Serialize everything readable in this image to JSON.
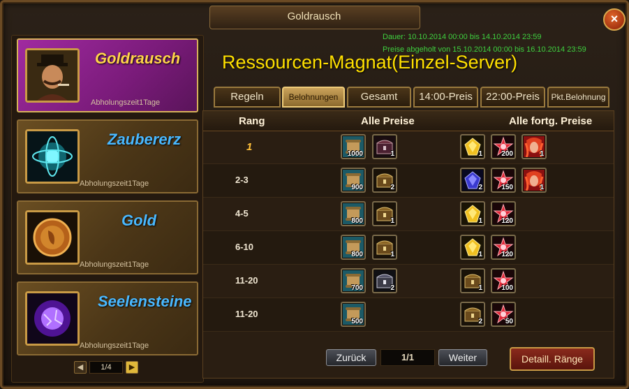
{
  "window": {
    "title": "Goldrausch",
    "close_label": "×"
  },
  "left": {
    "cards": [
      {
        "title": "Goldrausch",
        "sub": "Abholungszeit1Tage",
        "icon": "gentleman-portrait-icon"
      },
      {
        "title": "Zaubererz",
        "sub": "Abholungszeit1Tage",
        "icon": "magic-orb-icon"
      },
      {
        "title": "Gold",
        "sub": "Abholungszeit1Tage",
        "icon": "gold-coin-icon"
      },
      {
        "title": "Seelensteine",
        "sub": "Abholungszeit1Tage",
        "icon": "soul-stone-icon"
      }
    ],
    "pager": {
      "text": "1/4",
      "prev": "◀",
      "next": "▶"
    }
  },
  "info": {
    "duration": "Dauer: 10.10.2014 00:00 bis 14.10.2014 23:59",
    "claim": "Preise abgeholt von 15.10.2014 00:00 bis 16.10.2014 23:59",
    "event_title": "Ressourcen-Magnat(Einzel-Server)"
  },
  "tabs": [
    {
      "label": "Regeln"
    },
    {
      "label": "Belohnungen"
    },
    {
      "label": "Gesamt"
    },
    {
      "label": "14:00-Preis"
    },
    {
      "label": "22:00-Preis"
    },
    {
      "label": "Pkt.Belohnung"
    }
  ],
  "table": {
    "headers": {
      "rank": "Rang",
      "all": "Alle Preise",
      "adv": "Alle fortg. Preise"
    },
    "rows": [
      {
        "rank": "1",
        "all": [
          {
            "icon": "scroll-icon",
            "qty": "1000"
          },
          {
            "icon": "dark-chest-icon",
            "qty": "1"
          }
        ],
        "adv": [
          {
            "icon": "gold-crystal-icon",
            "qty": "1"
          },
          {
            "icon": "red-gem-icon",
            "qty": "200"
          },
          {
            "icon": "hero-portrait-icon",
            "qty": "1"
          }
        ]
      },
      {
        "rank": "2-3",
        "all": [
          {
            "icon": "scroll-icon",
            "qty": "900"
          },
          {
            "icon": "gold-chest-icon",
            "qty": "2"
          }
        ],
        "adv": [
          {
            "icon": "blue-crystal-icon",
            "qty": "2"
          },
          {
            "icon": "red-gem-icon",
            "qty": "150"
          },
          {
            "icon": "hero-portrait-icon",
            "qty": "1"
          }
        ]
      },
      {
        "rank": "4-5",
        "all": [
          {
            "icon": "scroll-icon",
            "qty": "800"
          },
          {
            "icon": "gold-chest-icon",
            "qty": "1"
          }
        ],
        "adv": [
          {
            "icon": "gold-crystal-icon",
            "qty": "1"
          },
          {
            "icon": "red-gem-icon",
            "qty": "120"
          }
        ]
      },
      {
        "rank": "6-10",
        "all": [
          {
            "icon": "scroll-icon",
            "qty": "800"
          },
          {
            "icon": "gold-chest-icon",
            "qty": "1"
          }
        ],
        "adv": [
          {
            "icon": "gold-crystal-icon",
            "qty": "1"
          },
          {
            "icon": "red-gem-icon",
            "qty": "120"
          }
        ]
      },
      {
        "rank": "11-20",
        "all": [
          {
            "icon": "scroll-icon",
            "qty": "700"
          },
          {
            "icon": "silver-chest-icon",
            "qty": "2"
          }
        ],
        "adv": [
          {
            "icon": "gold-chest-icon",
            "qty": "1"
          },
          {
            "icon": "red-gem-icon",
            "qty": "100"
          }
        ]
      },
      {
        "rank": "11-20",
        "all": [
          {
            "icon": "scroll-icon",
            "qty": "500"
          }
        ],
        "adv": [
          {
            "icon": "gold-chest-icon",
            "qty": "2"
          },
          {
            "icon": "red-gem-icon",
            "qty": "50"
          }
        ]
      }
    ]
  },
  "bottom": {
    "back": "Zurück",
    "page": "1/1",
    "next": "Weiter",
    "detail": "Detaill. Ränge"
  }
}
